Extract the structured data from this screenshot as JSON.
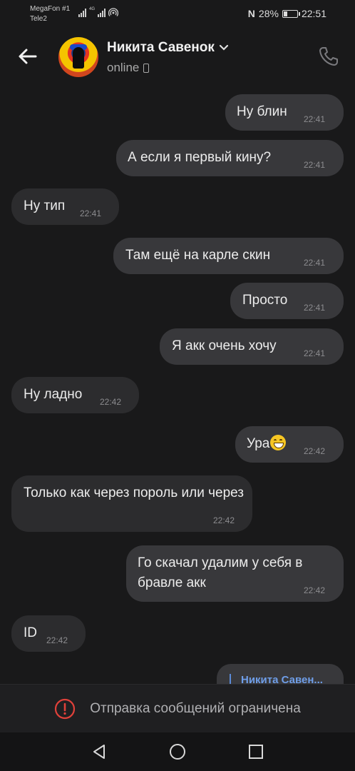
{
  "status": {
    "carrier1": "MegaFon #1",
    "carrier2": "Tele2",
    "net_label": "4G",
    "nfc": "N",
    "battery": "28%",
    "battery_level": 0.28,
    "time": "22:51"
  },
  "header": {
    "name": "Никита Савенок",
    "presence": "online"
  },
  "messages": [
    {
      "dir": "out",
      "text": "Ну блин",
      "time": "22:41"
    },
    {
      "dir": "out",
      "text": "А если я первый кину?",
      "time": "22:41"
    },
    {
      "dir": "in",
      "text": "Ну тип",
      "time": "22:41"
    },
    {
      "dir": "out",
      "text": "Там ещё на карле скин",
      "time": "22:41"
    },
    {
      "dir": "out",
      "text": "Просто",
      "time": "22:41"
    },
    {
      "dir": "out",
      "text": "Я акк очень хочу",
      "time": "22:41"
    },
    {
      "dir": "in",
      "text": "Ну ладно",
      "time": "22:42"
    },
    {
      "dir": "out",
      "text": "Ура",
      "emoji": "grinning-face",
      "time": "22:42"
    },
    {
      "dir": "in",
      "text": "Только как через пороль или через",
      "time": "22:42"
    },
    {
      "dir": "out",
      "text": "Го скачал удалим у себя в бравле акк",
      "time": "22:42"
    },
    {
      "dir": "in",
      "text": "ID",
      "time": "22:42"
    }
  ],
  "reply_peek": {
    "name": "Никита Савен..."
  },
  "restricted": {
    "text": "Отправка сообщений ограничена"
  },
  "colors": {
    "background": "#19191a",
    "bubble_in": "#2c2c2e",
    "bubble_out": "#38383b",
    "accent": "#6f9ee8",
    "warning": "#e0413a"
  }
}
